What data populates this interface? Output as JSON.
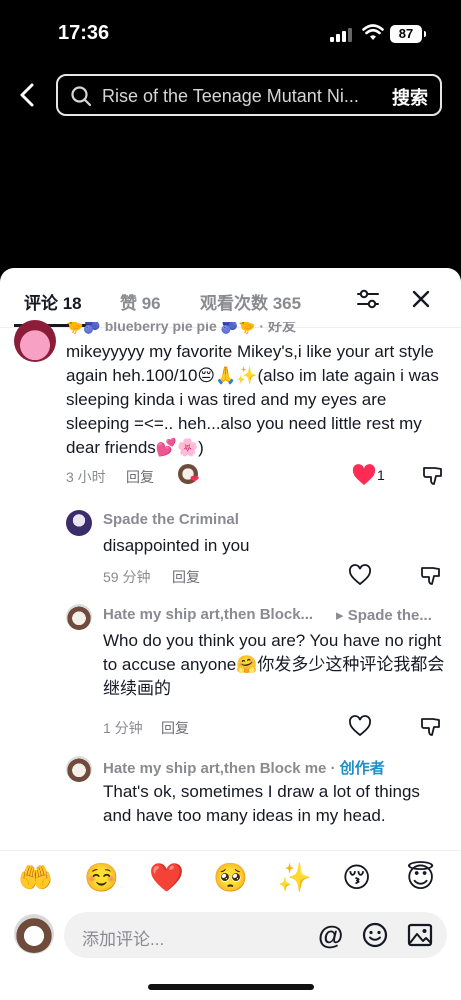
{
  "status_bar": {
    "time": "17:36",
    "battery": "87"
  },
  "search": {
    "query": "Rise of the Teenage Mutant Ni...",
    "button_label": "搜索"
  },
  "tabs": [
    {
      "label": "评论 18"
    },
    {
      "label": "赞 96"
    },
    {
      "label": "观看次数 365"
    }
  ],
  "comments": [
    {
      "cut_username": "🐤🫐 blueberry pie pie 🫐🐤 · 好友",
      "text": "mikeyyyyy my favorite Mikey's,i like your art style again heh.100/10😔🙏✨(also im late again i was sleeping kinda i was tired and my eyes are sleeping =<=.. heh...also you need little rest my dear friends💕🌸)",
      "time": "3 小时",
      "reply_label": "回复",
      "likes": "1"
    },
    {
      "username": "Spade the Criminal",
      "text": "disappointed in you",
      "time": "59 分钟",
      "reply_label": "回复"
    },
    {
      "username": "Hate my ship art,then Block...",
      "reply_to": "▸ Spade the...",
      "text": "Who do you think you are? You have no right to accuse anyone🤗你发多少这种评论我都会继续画的",
      "time": "1 分钟",
      "reply_label": "回复"
    },
    {
      "username": "Hate my ship art,then Block me",
      "separator": " · ",
      "badge": "创作者",
      "text": "That's ok, sometimes I draw a lot of things and have too many ideas in my head."
    }
  ],
  "emoji_bar": [
    "🤲",
    "☺️",
    "❤️",
    "🥺",
    "✨",
    "😚",
    "😇"
  ],
  "comment_input": {
    "placeholder": "添加评论...",
    "at_symbol": "@"
  },
  "colors": {
    "like_red": "#fe2c55",
    "creator_blue": "#1f8ec7",
    "sheet_bg": "#ffffff",
    "header_bg": "#000000"
  }
}
